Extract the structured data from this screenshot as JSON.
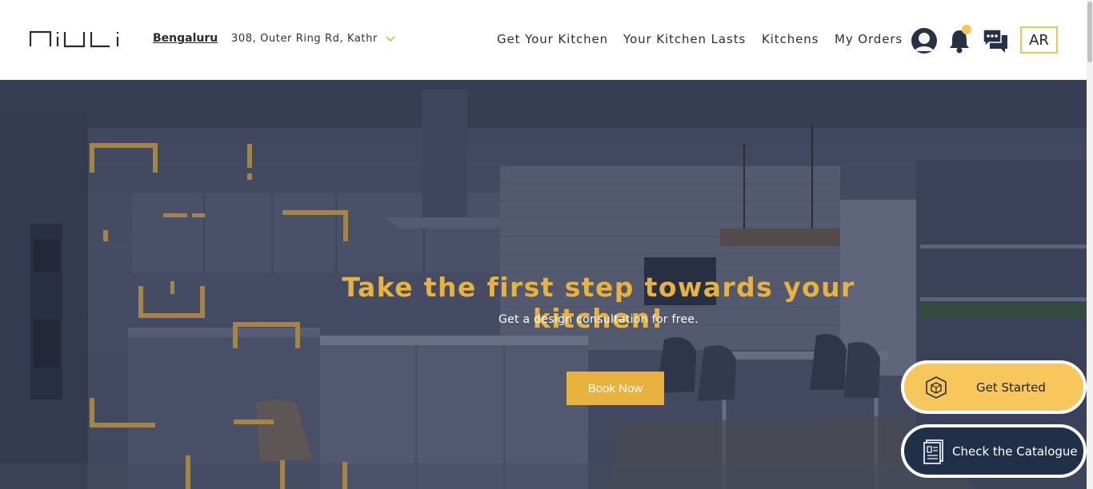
{
  "header": {
    "logo_text": "niuli",
    "city": "Bengaluru",
    "address": "308, Outer Ring Rd, Kathr",
    "nav": [
      "Get Your Kitchen",
      "Your Kitchen Lasts",
      "Kitchens",
      "My Orders"
    ],
    "ar_label": "AR"
  },
  "hero": {
    "title": "Take the first step towards your kitchen!",
    "subtitle": "Get a design consultation for free.",
    "cta_label": "Book Now"
  },
  "floating": {
    "get_started": "Get Started",
    "catalogue": "Check the Catalogue"
  },
  "colors": {
    "accent": "#e8b23f",
    "fab_yellow": "#f8c75c",
    "fab_navy": "#203049",
    "notification_dot": "#f2c554"
  },
  "icons": [
    "user-avatar-icon",
    "bell-icon",
    "chat-icon",
    "chevron-down-icon",
    "box-icon",
    "catalogue-icon"
  ]
}
